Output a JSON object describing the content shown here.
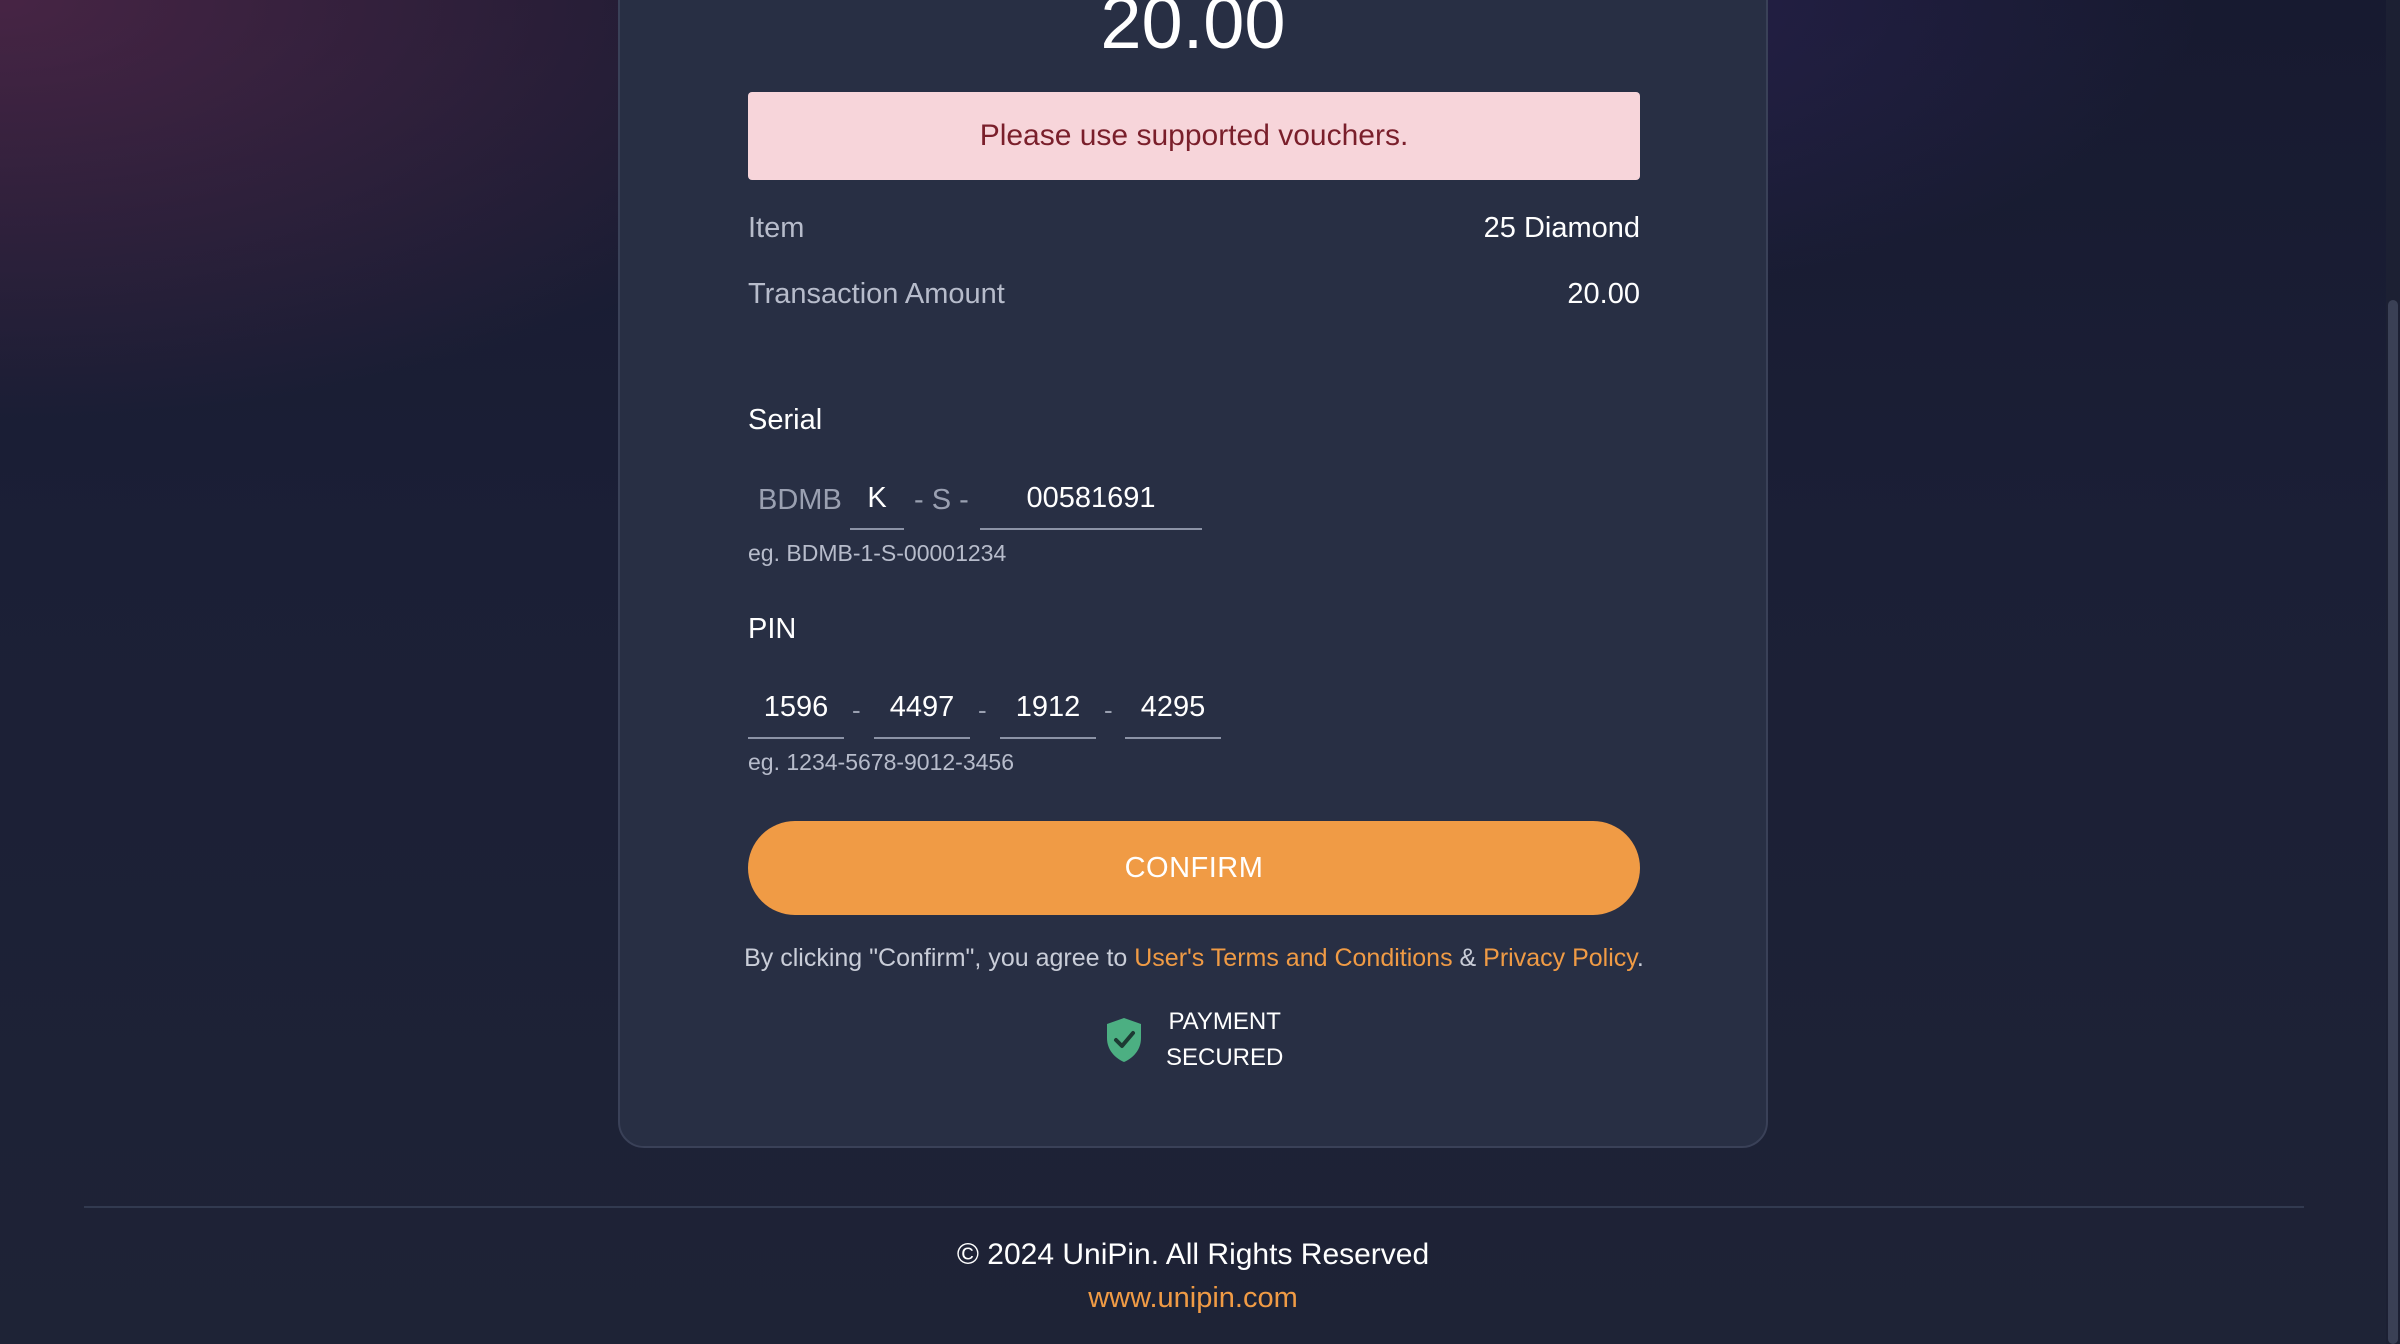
{
  "header": {
    "amount": "20.00"
  },
  "alert": {
    "message": "Please use supported vouchers."
  },
  "summary": {
    "item_label": "Item",
    "item_value": "25 Diamond",
    "amount_label": "Transaction Amount",
    "amount_value": "20.00"
  },
  "serial": {
    "label": "Serial",
    "prefix": "BDMB",
    "part1": "K",
    "middle": "- S -",
    "part2": "00581691",
    "hint": "eg. BDMB-1-S-00001234"
  },
  "pin": {
    "label": "PIN",
    "parts": [
      "1596",
      "4497",
      "1912",
      "4295"
    ],
    "separator": "-",
    "hint": "eg. 1234-5678-9012-3456"
  },
  "confirm": {
    "label": "CONFIRM"
  },
  "terms": {
    "prefix": "By clicking \"Confirm\", you agree to ",
    "terms_link": "User's Terms and Conditions",
    "amp": " & ",
    "privacy_link": "Privacy Policy",
    "suffix": "."
  },
  "secured": {
    "line1": "PAYMENT",
    "line2": "SECURED",
    "icon": "shield-check-icon"
  },
  "footer": {
    "copyright": "© 2024 UniPin. All Rights Reserved",
    "website": "www.unipin.com"
  },
  "colors": {
    "accent": "#f09b45",
    "alert_bg": "#f7d5da",
    "alert_text": "#7a1f2b",
    "card_bg": "#282f44",
    "secure_green": "#4caf82"
  }
}
